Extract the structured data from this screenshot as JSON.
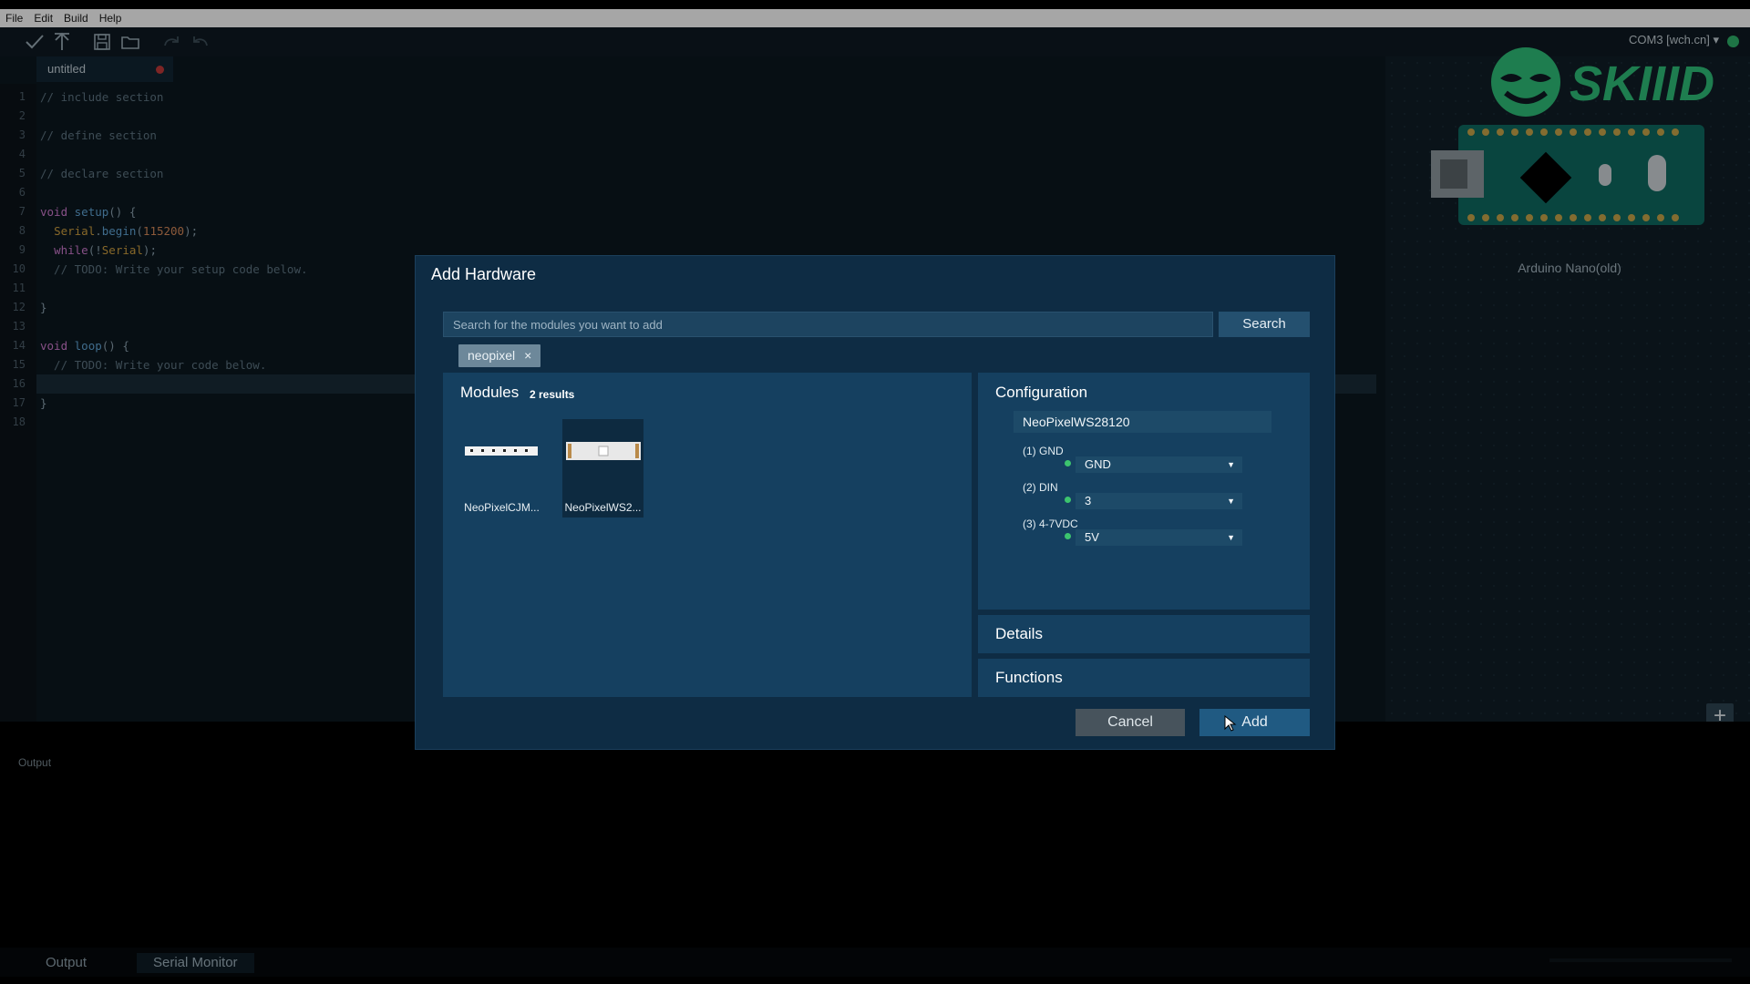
{
  "menu": {
    "items": [
      "File",
      "Edit",
      "Build",
      "Help"
    ]
  },
  "toolbar": {
    "port_label": "COM3 [wch.cn] ▾"
  },
  "editor": {
    "tab_title": "untitled",
    "lines": [
      {
        "no": "1",
        "text": "// include section"
      },
      {
        "no": "2",
        "text": ""
      },
      {
        "no": "3",
        "text": "// define section"
      },
      {
        "no": "4",
        "text": ""
      },
      {
        "no": "5",
        "text": "// declare section"
      },
      {
        "no": "6",
        "text": ""
      },
      {
        "no": "7",
        "text": "void setup() {"
      },
      {
        "no": "8",
        "text": "  Serial.begin(115200);"
      },
      {
        "no": "9",
        "text": "  while(!Serial);"
      },
      {
        "no": "10",
        "text": "  // TODO: Write your setup code below."
      },
      {
        "no": "11",
        "text": ""
      },
      {
        "no": "12",
        "text": "}"
      },
      {
        "no": "13",
        "text": ""
      },
      {
        "no": "14",
        "text": "void loop() {"
      },
      {
        "no": "15",
        "text": "  // TODO: Write your code below."
      },
      {
        "no": "16",
        "text": ""
      },
      {
        "no": "17",
        "text": "}"
      },
      {
        "no": "18",
        "text": ""
      }
    ]
  },
  "board": {
    "name": "Arduino Nano(old)",
    "logo_text": "SKIIID",
    "add_icon": "+"
  },
  "output": {
    "label": "Output"
  },
  "bottom_tabs": {
    "output": "Output",
    "serial_monitor": "Serial Monitor"
  },
  "modal": {
    "title": "Add Hardware",
    "search_placeholder": "Search for the modules you want to add",
    "search_value": "",
    "search_button": "Search",
    "filter_chip": {
      "label": "neopixel",
      "close": "×"
    },
    "modules": {
      "title": "Modules",
      "count": "2 results",
      "items": [
        {
          "name": "NeoPixelCJM..."
        },
        {
          "name": "NeoPixelWS2..."
        }
      ]
    },
    "config": {
      "title": "Configuration",
      "name_value": "NeoPixelWS28120",
      "pins": [
        {
          "label": "(1) GND",
          "value": "GND"
        },
        {
          "label": "(2) DIN",
          "value": "3"
        },
        {
          "label": "(3) 4-7VDC",
          "value": "5V"
        }
      ]
    },
    "details_label": "Details",
    "functions_label": "Functions",
    "cancel_label": "Cancel",
    "add_label": "Add"
  },
  "colors": {
    "accent": "#205a82",
    "pin_ok": "#3cc46e",
    "logo_green": "#2fc07a"
  }
}
